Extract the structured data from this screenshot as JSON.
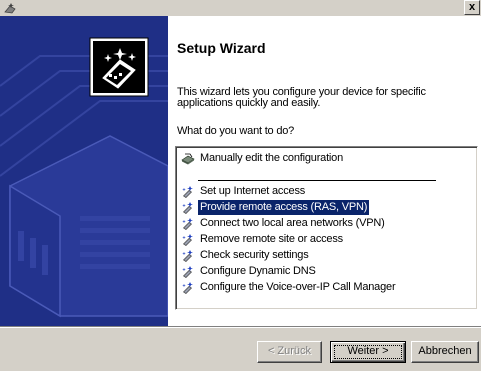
{
  "window": {
    "title_icon": "wizard-app-icon",
    "close_label": "x"
  },
  "header": {
    "title": "Setup Wizard",
    "description": "This wizard lets you configure your device for specific applications quickly and easily.",
    "question": "What do you want to do?"
  },
  "options": [
    {
      "label": "Manually edit the configuration",
      "icon": "network-card-icon",
      "selected": false
    },
    {
      "label": "Set up Internet access",
      "icon": "wizard-wand-icon",
      "selected": false
    },
    {
      "label": "Provide remote access (RAS, VPN)",
      "icon": "wizard-wand-icon",
      "selected": true
    },
    {
      "label": "Connect two local area networks (VPN)",
      "icon": "wizard-wand-icon",
      "selected": false
    },
    {
      "label": "Remove remote site or access",
      "icon": "wizard-wand-icon",
      "selected": false
    },
    {
      "label": "Check security settings",
      "icon": "wizard-wand-icon",
      "selected": false
    },
    {
      "label": "Configure Dynamic DNS",
      "icon": "wizard-wand-icon",
      "selected": false
    },
    {
      "label": "Configure the Voice-over-IP Call Manager",
      "icon": "wizard-wand-icon",
      "selected": false
    }
  ],
  "buttons": {
    "back_label": "< Zurück",
    "next_label": "Weiter >",
    "cancel_label": "Abbrechen"
  },
  "colors": {
    "banner": "#1f2f86",
    "selection": "#0a246a",
    "dialog_face": "#d4d0c8"
  }
}
